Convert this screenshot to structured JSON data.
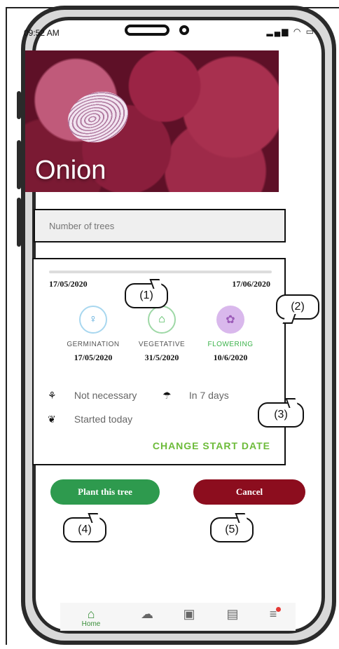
{
  "status_bar": {
    "time": "09:52 AM",
    "icons": "signal wifi battery"
  },
  "hero": {
    "title": "Onion"
  },
  "trees_input": {
    "placeholder": "Number of trees"
  },
  "timeline": {
    "start_date": "17/05/2020",
    "end_date": "17/06/2020",
    "progress": 0
  },
  "stages": [
    {
      "name": "GERMINATION",
      "date": "17/05/2020",
      "icon": "seedling-icon",
      "color": "#4aa3d8"
    },
    {
      "name": "VEGETATIVE",
      "date": "31/5/2020",
      "icon": "tree-icon",
      "color": "#3bb34a"
    },
    {
      "name": "FLOWERING",
      "date": "10/6/2020",
      "icon": "flower-tree-icon",
      "color": "#9b5ab8"
    }
  ],
  "care": {
    "fertilize": "Not necessary",
    "water": "In 7 days",
    "growth": "Started today"
  },
  "change_start_date": "CHANGE START DATE",
  "buttons": {
    "plant": "Plant this tree",
    "cancel": "Cancel"
  },
  "callouts": [
    "(1)",
    "(2)",
    "(3)",
    "(4)",
    "(5)"
  ],
  "nav": {
    "home_label": "Home"
  },
  "colors": {
    "primary_green": "#2e9a4e",
    "cancel_red": "#8c0d1e",
    "accent_green": "#6dbb3a"
  }
}
